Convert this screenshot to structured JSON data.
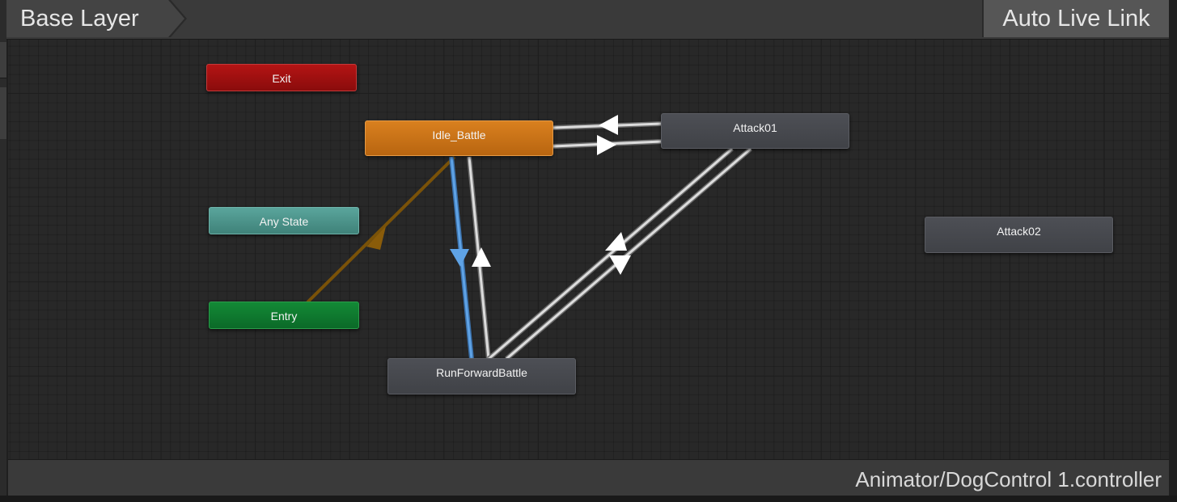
{
  "header": {
    "layer": "Base Layer",
    "live_link": "Auto Live Link"
  },
  "states": {
    "exit": "Exit",
    "any_state": "Any State",
    "entry": "Entry",
    "idle_battle": "Idle_Battle",
    "attack01": "Attack01",
    "attack02": "Attack02",
    "run_forward_battle": "RunForwardBattle"
  },
  "footer": {
    "controller_path": "Animator/DogControl 1.controller"
  },
  "colors": {
    "exit": "#a11010",
    "any_state": "#4c948b",
    "entry": "#0f7a2f",
    "default_state": "#c9731a",
    "state": "#46484d",
    "default_transition": "#7a5208",
    "selected_transition": "#4f95d9",
    "transition": "#cfcfcf"
  }
}
